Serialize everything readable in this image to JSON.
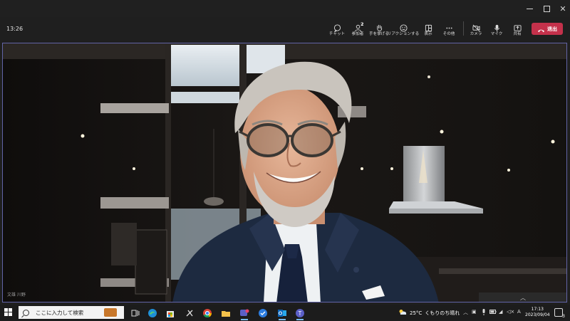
{
  "window": {
    "controls": {
      "minimize": "minimize-icon",
      "maximize": "maximize-icon",
      "close": "close-icon"
    }
  },
  "meeting": {
    "elapsed": "13:26",
    "toolbar": [
      {
        "id": "chat",
        "label": "チャット",
        "icon": "chat-icon"
      },
      {
        "id": "participants",
        "label": "参加者",
        "icon": "people-icon",
        "badge": "2"
      },
      {
        "id": "raise-hand",
        "label": "手を挙げる",
        "icon": "hand-icon"
      },
      {
        "id": "reactions",
        "label": "リアクションする",
        "icon": "smiley-icon"
      },
      {
        "id": "view",
        "label": "表示",
        "icon": "layout-icon"
      },
      {
        "id": "more",
        "label": "その他",
        "icon": "more-icon"
      },
      {
        "id": "camera",
        "label": "カメラ",
        "icon": "camera-icon"
      },
      {
        "id": "mic",
        "label": "マイク",
        "icon": "mic-icon"
      },
      {
        "id": "share",
        "label": "共有",
        "icon": "share-icon"
      }
    ],
    "leave_label": "退出",
    "participant_name": "文雄 川野",
    "accent": "#6264a7",
    "leave_color": "#c4314b"
  },
  "taskbar": {
    "search_placeholder": "ここに入力して検索",
    "apps": [
      "task-view-icon",
      "edge-icon",
      "store-icon",
      "snipping-icon",
      "chrome-icon",
      "explorer-icon",
      "teams-chat-icon",
      "vpn-icon",
      "outlook-icon",
      "teams-icon"
    ],
    "weather": {
      "temp": "25°C",
      "condition": "くもりのち晴れ"
    },
    "time": "17:13",
    "date": "2023/09/04",
    "ime": "A",
    "notifications": "3"
  }
}
